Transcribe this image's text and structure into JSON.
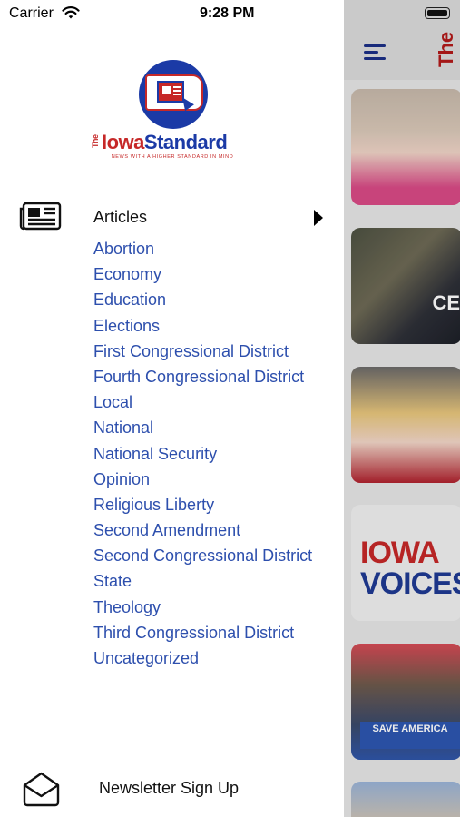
{
  "status_bar": {
    "carrier": "Carrier",
    "time": "9:28 PM"
  },
  "logo": {
    "the": "The",
    "iowa": "Iowa",
    "standard": "Standard",
    "tagline": "NEWS WITH A HIGHER STANDARD IN MIND"
  },
  "menu": {
    "articles_label": "Articles",
    "categories": [
      "Abortion",
      "Economy",
      "Education",
      "Elections",
      "First Congressional District",
      "Fourth Congressional District",
      "Local",
      "National",
      "National Security",
      "Opinion",
      "Religious Liberty",
      "Second Amendment",
      "Second Congressional District",
      "State",
      "Theology",
      "Third Congressional District",
      "Uncategorized"
    ],
    "newsletter_label": "Newsletter Sign Up"
  },
  "background_app": {
    "brand_text": "The",
    "thumb2_text": "CE",
    "thumb4_line1": "IOWA",
    "thumb4_line2": "VOICES",
    "thumb5_banner": "SAVE AMERICA"
  },
  "icons": {
    "wifi": "wifi-icon",
    "articles": "newspaper-icon",
    "expand": "triangle-right-icon",
    "newsletter": "envelope-open-icon",
    "menu": "hamburger-menu-icon",
    "battery": "battery-icon"
  },
  "colors": {
    "link_blue": "#2d4fad",
    "brand_red": "#c62828",
    "brand_blue": "#1b3aa6"
  }
}
